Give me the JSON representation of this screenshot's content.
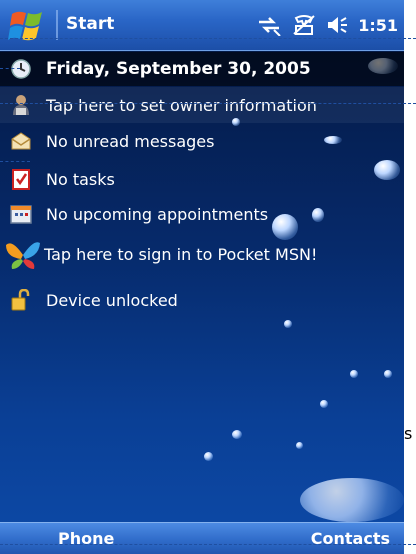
{
  "titlebar": {
    "start_label": "Start",
    "clock": "1:51"
  },
  "today": {
    "date": "Friday, September 30, 2005",
    "owner": "Tap here to set owner information",
    "messages": "No unread messages",
    "tasks": "No tasks",
    "appointments": "No upcoming appointments",
    "msn": "Tap here to sign in to Pocket MSN!",
    "device": "Device unlocked"
  },
  "softkeys": {
    "left": "Phone",
    "right": "Contacts"
  },
  "stray_text": "s",
  "colors": {
    "titlebar": "#2a66c7",
    "background": "#062a6b",
    "softbar": "#2f6bc9"
  },
  "icons": [
    "windows-start-icon",
    "connectivity-icon",
    "phone-off-icon",
    "volume-icon",
    "calendar-clock-icon",
    "owner-icon",
    "envelope-icon",
    "tasks-check-icon",
    "appointment-calendar-icon",
    "msn-butterfly-icon",
    "padlock-icon"
  ]
}
